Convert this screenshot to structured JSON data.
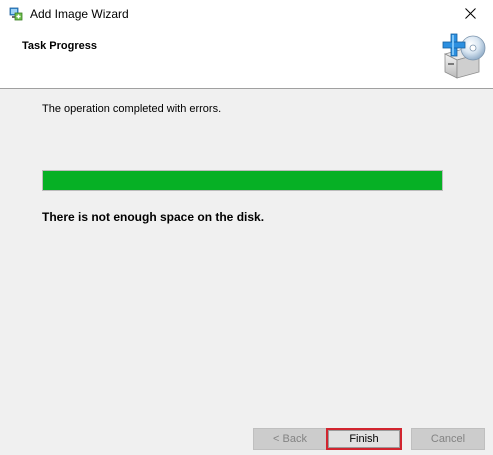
{
  "window": {
    "title": "Add Image Wizard",
    "app_icon": "wizard-app-icon",
    "close_icon": "close-icon"
  },
  "header": {
    "title": "Task Progress",
    "icon": "disk-add-icon"
  },
  "main": {
    "status_text": "The operation completed with errors.",
    "progress": {
      "value_percent": 100,
      "color": "#06b025"
    },
    "error_text": "There is not enough space on the disk."
  },
  "footer": {
    "back_label": "< Back",
    "finish_label": "Finish",
    "cancel_label": "Cancel"
  },
  "colors": {
    "progress_green": "#06b025",
    "focus_highlight": "#d1252f"
  }
}
